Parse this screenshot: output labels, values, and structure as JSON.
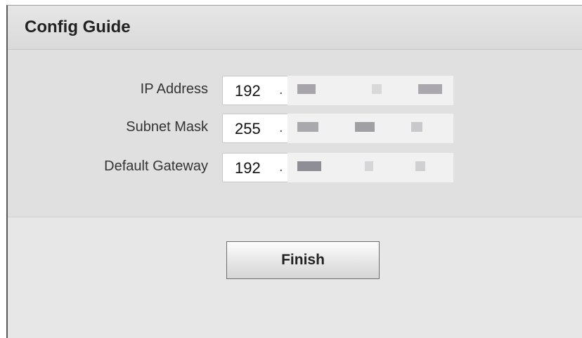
{
  "header": {
    "title": "Config Guide"
  },
  "fields": [
    {
      "label": "IP Address",
      "first_octet": "192",
      "separator": "."
    },
    {
      "label": "Subnet Mask",
      "first_octet": "255",
      "separator": "."
    },
    {
      "label": "Default Gateway",
      "first_octet": "192",
      "separator": "."
    }
  ],
  "actions": {
    "finish_label": "Finish"
  }
}
